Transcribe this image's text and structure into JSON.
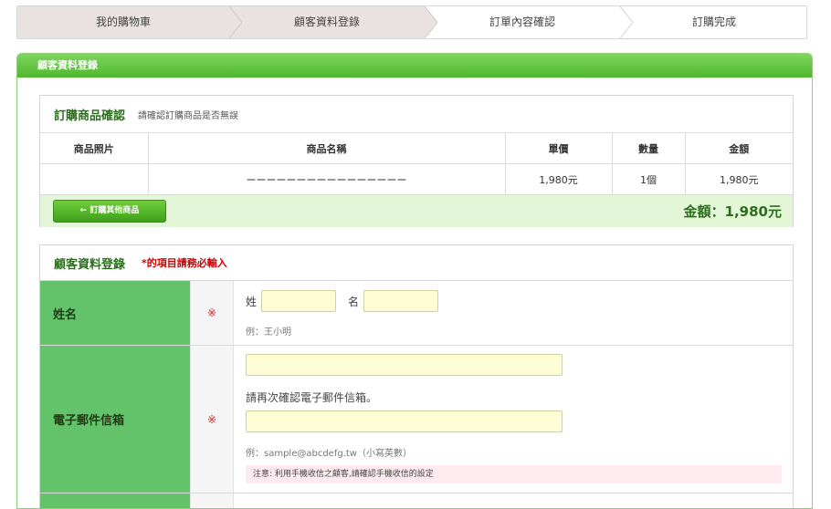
{
  "steps": [
    "我的購物車",
    "顧客資料登錄",
    "訂單內容確認",
    "訂購完成"
  ],
  "panel": {
    "title": "顧客資料登錄"
  },
  "order": {
    "title": "訂購商品確認",
    "subtitle": "請確認訂購商品是否無誤",
    "headers": [
      "商品照片",
      "商品名稱",
      "單價",
      "數量",
      "金額"
    ],
    "row": {
      "photo": "",
      "name": "ーーーーーーーーーーーーーーーー",
      "price": "1,980元",
      "qty": "1個",
      "amount": "1,980元"
    },
    "back_label": "← 訂購其他商品",
    "total": "金額：1,980元"
  },
  "customer": {
    "title": "顧客資料登錄",
    "required_note": "*的項目請務必輸入",
    "mark": "※",
    "name": {
      "label": "姓名",
      "last_label": "姓",
      "first_label": "名",
      "last_value": "",
      "first_value": "",
      "hint": "例：王小明"
    },
    "email": {
      "label": "電子郵件信箱",
      "value": "",
      "confirm_text": "請再次確認電子郵件信箱。",
      "confirm_value": "",
      "hint": "例：sample@abcdefg.tw（小寫英數）",
      "note": "注意: 利用手機收信之顧客,請確認手機收信的設定"
    }
  },
  "colors": {
    "accent": "#4fb72e",
    "label_bg": "#63c36b",
    "input_bg": "#fffdd6",
    "required": "#d8262d"
  }
}
